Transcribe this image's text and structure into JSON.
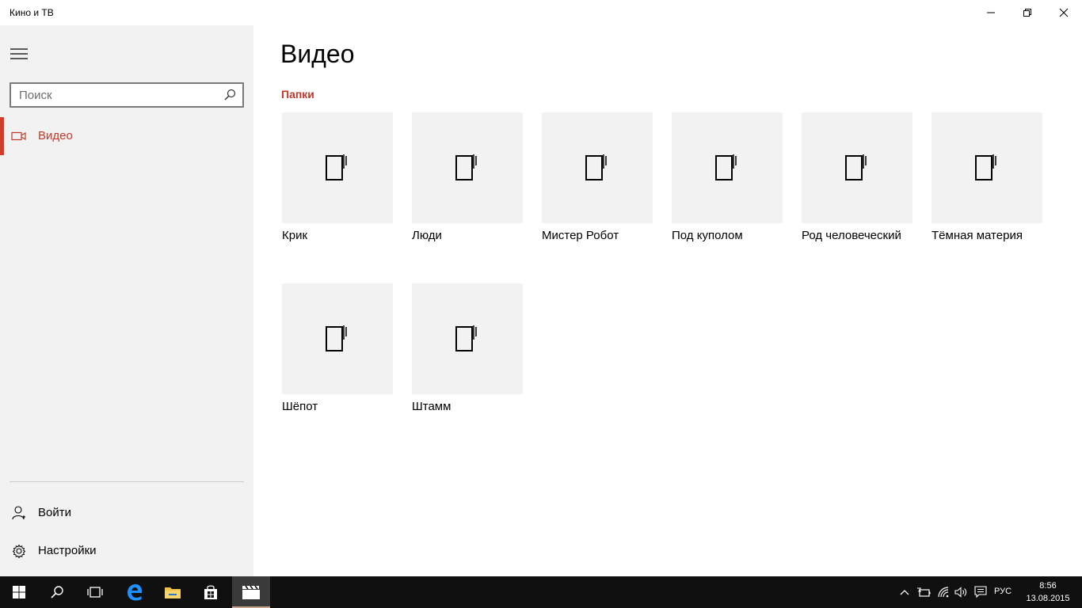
{
  "window": {
    "title": "Кино и ТВ"
  },
  "sidebar": {
    "search_placeholder": "Поиск",
    "nav": [
      {
        "label": "Видео",
        "icon": "video-camera-icon",
        "active": true
      }
    ],
    "footer": [
      {
        "label": "Войти",
        "icon": "person-icon"
      },
      {
        "label": "Настройки",
        "icon": "gear-icon"
      }
    ]
  },
  "main": {
    "title": "Видео",
    "section": "Папки",
    "folders": [
      {
        "name": "Крик"
      },
      {
        "name": "Люди"
      },
      {
        "name": "Мистер Робот"
      },
      {
        "name": "Под куполом"
      },
      {
        "name": "Род человеческий"
      },
      {
        "name": "Тёмная материя"
      },
      {
        "name": "Шёпот"
      },
      {
        "name": "Штамм"
      }
    ]
  },
  "taskbar": {
    "language": "РУС",
    "time": "8:56",
    "date": "13.08.2015"
  },
  "colors": {
    "accent": "#c1392b",
    "sidebar_bg": "#f2f2f2",
    "tile_bg": "#f2f2f2",
    "taskbar_bg": "#101010"
  }
}
